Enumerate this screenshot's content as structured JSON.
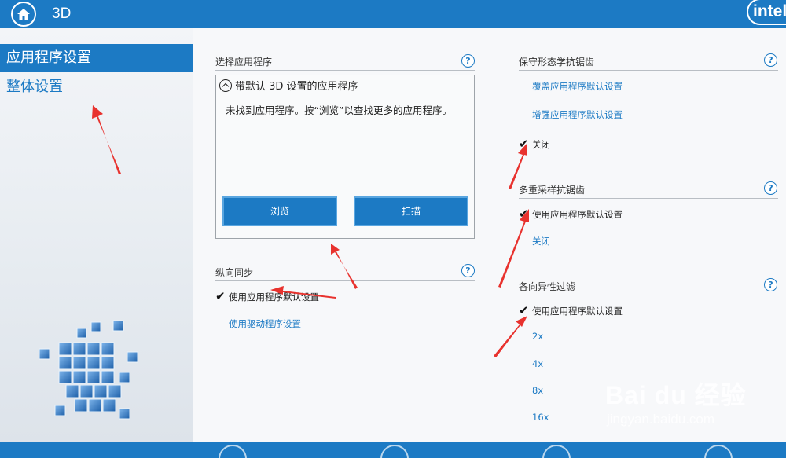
{
  "app": {
    "title": "3D",
    "logo_text": "intel"
  },
  "colors": {
    "accent": "#1c7ac4",
    "annotation_arrow": "#e8322e"
  },
  "sidebar": {
    "items": [
      {
        "label": "应用程序设置",
        "active": true
      },
      {
        "label": "整体设置",
        "active": false
      }
    ]
  },
  "app_select": {
    "title": "选择应用程序",
    "box_header": "带默认 3D 设置的应用程序",
    "message": "未找到应用程序。按“浏览”以查找更多的应用程序。",
    "browse_label": "浏览",
    "scan_label": "扫描"
  },
  "vsync": {
    "title": "纵向同步",
    "options": [
      {
        "label": "使用应用程序默认设置",
        "selected": true
      },
      {
        "label": "使用驱动程序设置",
        "selected": false
      }
    ]
  },
  "conservative_aa": {
    "title": "保守形态学抗锯齿",
    "options": [
      {
        "label": "覆盖应用程序默认设置",
        "selected": false
      },
      {
        "label": "增强应用程序默认设置",
        "selected": false
      },
      {
        "label": "关闭",
        "selected": true
      }
    ]
  },
  "msaa": {
    "title": "多重采样抗锯齿",
    "options": [
      {
        "label": "使用应用程序默认设置",
        "selected": true
      },
      {
        "label": "关闭",
        "selected": false
      }
    ]
  },
  "anisotropic": {
    "title": "各向异性过滤",
    "options": [
      {
        "label": "使用应用程序默认设置",
        "selected": true
      },
      {
        "label": "2x",
        "selected": false
      },
      {
        "label": "4x",
        "selected": false
      },
      {
        "label": "8x",
        "selected": false
      },
      {
        "label": "16x",
        "selected": false
      }
    ]
  },
  "help_symbol": "?",
  "check_symbol": "✔",
  "watermark": {
    "main": "Bai du 经验",
    "sub": "jingyan.baidu.com"
  }
}
